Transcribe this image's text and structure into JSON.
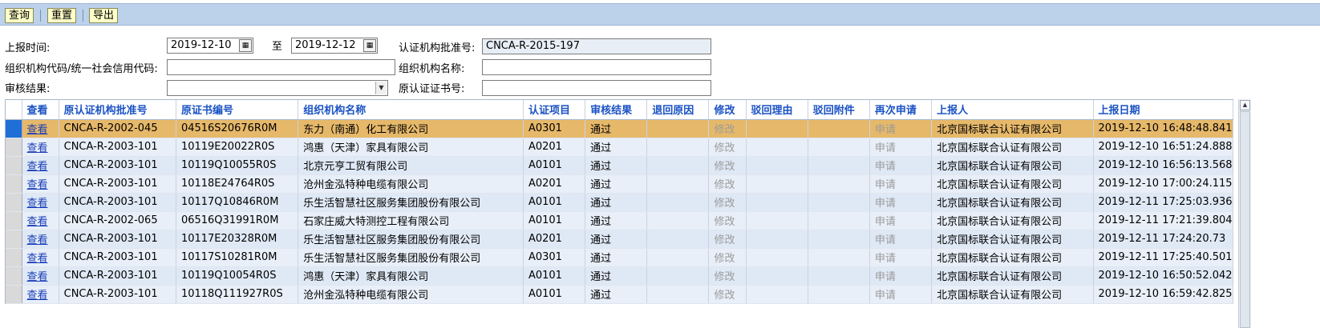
{
  "toolbar": {
    "query_label": "查询",
    "reset_label": "重置",
    "export_label": "导出"
  },
  "form": {
    "report_time_label": "上报时间:",
    "date_from": "2019-12-10",
    "to_label": "至",
    "date_to": "2019-12-12",
    "approval_no_label": "认证机构批准号:",
    "approval_no_value": "CNCA-R-2015-197",
    "org_code_label": "组织机构代码/统一社会信用代码:",
    "org_code_value": "",
    "org_name_label": "组织机构名称:",
    "org_name_value": "",
    "audit_result_label": "审核结果:",
    "audit_result_value": "",
    "orig_cert_label": "原认证证书号:",
    "orig_cert_value": ""
  },
  "grid": {
    "columns": [
      "查看",
      "原认证机构批准号",
      "原证书编号",
      "组织机构名称",
      "认证项目",
      "审核结果",
      "退回原因",
      "修改",
      "驳回理由",
      "驳回附件",
      "再次申请",
      "上报人",
      "上报日期"
    ],
    "rows": [
      {
        "view": "查看",
        "approval": "CNCA-R-2002-045",
        "cert": "04516S20676R0M",
        "org": "东力（南通）化工有限公司",
        "item": "A0301",
        "result": "通过",
        "return_reason": "",
        "edit": "修改",
        "reject_reason": "",
        "reject_att": "",
        "reapply": "申请",
        "reporter": "北京国标联合认证有限公司",
        "date": "2019-12-10 16:48:48.841"
      },
      {
        "view": "查看",
        "approval": "CNCA-R-2003-101",
        "cert": "10119E20022R0S",
        "org": "鸿惠（天津）家具有限公司",
        "item": "A0201",
        "result": "通过",
        "return_reason": "",
        "edit": "修改",
        "reject_reason": "",
        "reject_att": "",
        "reapply": "申请",
        "reporter": "北京国标联合认证有限公司",
        "date": "2019-12-10 16:51:24.888"
      },
      {
        "view": "查看",
        "approval": "CNCA-R-2003-101",
        "cert": "10119Q10055R0S",
        "org": "北京元亨工贸有限公司",
        "item": "A0101",
        "result": "通过",
        "return_reason": "",
        "edit": "修改",
        "reject_reason": "",
        "reject_att": "",
        "reapply": "申请",
        "reporter": "北京国标联合认证有限公司",
        "date": "2019-12-10 16:56:13.568"
      },
      {
        "view": "查看",
        "approval": "CNCA-R-2003-101",
        "cert": "10118E24764R0S",
        "org": "沧州金泓特种电缆有限公司",
        "item": "A0201",
        "result": "通过",
        "return_reason": "",
        "edit": "修改",
        "reject_reason": "",
        "reject_att": "",
        "reapply": "申请",
        "reporter": "北京国标联合认证有限公司",
        "date": "2019-12-10 17:00:24.115"
      },
      {
        "view": "查看",
        "approval": "CNCA-R-2003-101",
        "cert": "10117Q10846R0M",
        "org": "乐生活智慧社区服务集团股份有限公司",
        "item": "A0101",
        "result": "通过",
        "return_reason": "",
        "edit": "修改",
        "reject_reason": "",
        "reject_att": "",
        "reapply": "申请",
        "reporter": "北京国标联合认证有限公司",
        "date": "2019-12-11 17:25:03.936"
      },
      {
        "view": "查看",
        "approval": "CNCA-R-2002-065",
        "cert": "06516Q31991R0M",
        "org": "石家庄威大特测控工程有限公司",
        "item": "A0101",
        "result": "通过",
        "return_reason": "",
        "edit": "修改",
        "reject_reason": "",
        "reject_att": "",
        "reapply": "申请",
        "reporter": "北京国标联合认证有限公司",
        "date": "2019-12-11 17:21:39.804"
      },
      {
        "view": "查看",
        "approval": "CNCA-R-2003-101",
        "cert": "10117E20328R0M",
        "org": "乐生活智慧社区服务集团股份有限公司",
        "item": "A0201",
        "result": "通过",
        "return_reason": "",
        "edit": "修改",
        "reject_reason": "",
        "reject_att": "",
        "reapply": "申请",
        "reporter": "北京国标联合认证有限公司",
        "date": "2019-12-11 17:24:20.73"
      },
      {
        "view": "查看",
        "approval": "CNCA-R-2003-101",
        "cert": "10117S10281R0M",
        "org": "乐生活智慧社区服务集团股份有限公司",
        "item": "A0301",
        "result": "通过",
        "return_reason": "",
        "edit": "修改",
        "reject_reason": "",
        "reject_att": "",
        "reapply": "申请",
        "reporter": "北京国标联合认证有限公司",
        "date": "2019-12-11 17:25:40.501"
      },
      {
        "view": "查看",
        "approval": "CNCA-R-2003-101",
        "cert": "10119Q10054R0S",
        "org": "鸿惠（天津）家具有限公司",
        "item": "A0101",
        "result": "通过",
        "return_reason": "",
        "edit": "修改",
        "reject_reason": "",
        "reject_att": "",
        "reapply": "申请",
        "reporter": "北京国标联合认证有限公司",
        "date": "2019-12-10 16:50:52.042"
      },
      {
        "view": "查看",
        "approval": "CNCA-R-2003-101",
        "cert": "10118Q111927R0S",
        "org": "沧州金泓特种电缆有限公司",
        "item": "A0101",
        "result": "通过",
        "return_reason": "",
        "edit": "修改",
        "reject_reason": "",
        "reject_att": "",
        "reapply": "申请",
        "reporter": "北京国标联合认证有限公司",
        "date": "2019-12-10 16:59:42.825"
      }
    ],
    "selected_row": 0
  }
}
